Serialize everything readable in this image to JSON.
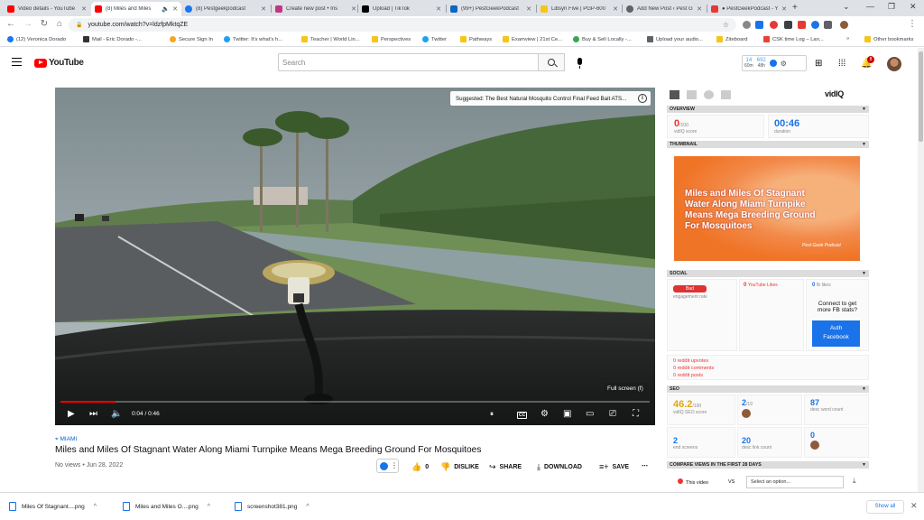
{
  "browser": {
    "tabs": [
      {
        "label": "Video details - YouTube",
        "color": "#ff0000",
        "active": false
      },
      {
        "label": "(8) Miles and Miles",
        "color": "#ff0000",
        "active": true
      },
      {
        "label": "(8) Pestgeekpodcast",
        "color": "#1877f2",
        "active": false
      },
      {
        "label": "Create new post • Ins",
        "color": "#c13584",
        "active": false
      },
      {
        "label": "Upload | TikTok",
        "color": "#000000",
        "active": false
      },
      {
        "label": "(99+) PestGeekPodcast",
        "color": "#0a66c2",
        "active": false
      },
      {
        "label": "Libsyn Five | PGP-600",
        "color": "#f5c518",
        "active": false
      },
      {
        "label": "Add New Post ‹ Pest G",
        "color": "#5f6368",
        "active": false
      },
      {
        "label": "● PestGeekPodcast - Y",
        "color": "#e53935",
        "active": false
      }
    ],
    "url": "youtube.com/watch?v=ldzfpMktqZE",
    "bookmarks": [
      {
        "label": "(12) Veronica Dorado",
        "color": "#1877f2"
      },
      {
        "label": "Mail - Eric Dorado -...",
        "color": "#333333"
      },
      {
        "label": "Secure Sign In",
        "color": "#f5a623"
      },
      {
        "label": "Twitter: It's what's h...",
        "color": "#1da1f2"
      },
      {
        "label": "Teacher | World Lin...",
        "color": "#f5c518"
      },
      {
        "label": "Perspectives",
        "color": "#f5c518"
      },
      {
        "label": "Twitter",
        "color": "#1da1f2"
      },
      {
        "label": "Pathways",
        "color": "#f5c518"
      },
      {
        "label": "Examview | 21st Ce...",
        "color": "#f5c518"
      },
      {
        "label": "Buy & Sell Locally -...",
        "color": "#34a853"
      },
      {
        "label": "Upload your audio...",
        "color": "#5f6368"
      },
      {
        "label": "Ziteboard",
        "color": "#f5c518"
      },
      {
        "label": "CSK time Log – Lan...",
        "color": "#ea4335"
      }
    ],
    "other_bookmarks": "Other bookmarks"
  },
  "masthead": {
    "logo_text": "YouTube",
    "search_placeholder": "Search",
    "vidiq_chip": {
      "stat1_value": "14",
      "stat1_label": "60m",
      "stat2_value": "692",
      "stat2_label": "48h"
    },
    "notification_count": "8"
  },
  "player": {
    "suggestion": "Suggested: The Best Natural Mosquito Control Final Feed Bait ATS...",
    "info_glyph": "i",
    "fullscreen_tooltip": "Full screen (f)",
    "time_current": "0:04",
    "time_total": "0:46",
    "progress_fraction": 0.093,
    "cc_label": "CC"
  },
  "video": {
    "location": "MIAMI",
    "title": "Miles and Miles Of Stagnant Water Along Miami Turnpike Means Mega Breeding Ground For Mosquitoes",
    "meta": "No views • Jun 28, 2022",
    "likes": "0",
    "dislike_label": "DISLIKE",
    "share_label": "SHARE",
    "download_label": "DOWNLOAD",
    "save_label": "SAVE"
  },
  "vidiq": {
    "logo_main": "vidIQ",
    "sections": {
      "overview": "OVERVIEW",
      "thumbnail": "THUMBNAIL",
      "social": "SOCIAL",
      "seo": "SEO",
      "compare": "COMPARE VIEWS IN THE FIRST 28 DAYS"
    },
    "overview": {
      "score": "0",
      "score_max": "/100",
      "score_label": "vidIQ score",
      "duration": "00:46",
      "duration_label": "duration"
    },
    "thumbnail_text": "Miles and Miles Of Stagnant Water Along Miami Turnpike Means Mega Breeding Ground For Mosquitoes",
    "thumbnail_brand": "Pest Geek Podcast",
    "social": {
      "engagement_badge": "Bad",
      "engagement_label": "engagement rate",
      "youtube_likes": "0",
      "youtube_likes_label": "YouTube Likes",
      "fb_likes": "0",
      "fb_likes_label": "fb likes",
      "connect_prompt_1": "Connect to get",
      "connect_prompt_2": "more FB stats?",
      "auth_label_1": "Auth",
      "auth_label_2": "Facebook",
      "reddit_upvotes": "0",
      "reddit_upvotes_label": "reddit upvotes",
      "reddit_comments": "0",
      "reddit_comments_label": "reddit comments",
      "reddit_posts": "0",
      "reddit_posts_label": "reddit posts"
    },
    "seo": {
      "seo_score": "46.2",
      "seo_score_max": "/100",
      "seo_score_label": "vidIQ SEO score",
      "tags": "2",
      "tags_max": "/19",
      "desc_word_count": "87",
      "desc_word_count_label": "desc word count",
      "end_screens": "2",
      "end_screens_label": "end screens",
      "desc_link_count": "20",
      "desc_link_count_label": "desc link count",
      "cards": "0"
    },
    "compare": {
      "this_video": "This video",
      "vs": "VS",
      "select_placeholder": "Select an option..."
    }
  },
  "downloads": {
    "items": [
      "Miles Of Stagnant....png",
      "Miles and Miles O....png",
      "screenshot381.png"
    ],
    "show_all": "Show all"
  }
}
